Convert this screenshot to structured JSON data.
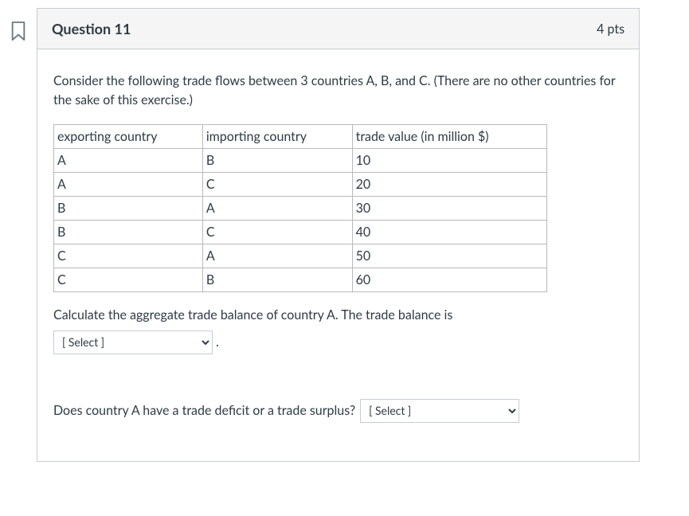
{
  "header": {
    "title": "Question 11",
    "points": "4 pts"
  },
  "body": {
    "intro": "Consider the following trade flows between 3 countries A, B, and C. (There are no other countries for the sake of this exercise.)",
    "table": {
      "headers": [
        "exporting country",
        "importing country",
        "trade value (in million $)"
      ],
      "rows": [
        [
          "A",
          "B",
          "10"
        ],
        [
          "A",
          "C",
          "20"
        ],
        [
          "B",
          "A",
          "30"
        ],
        [
          "B",
          "C",
          "40"
        ],
        [
          "C",
          "A",
          "50"
        ],
        [
          "C",
          "B",
          "60"
        ]
      ]
    },
    "q1_text": "Calculate the aggregate trade balance of country A. The trade balance is",
    "q1_placeholder": "[ Select ]",
    "q1_after": ".",
    "q2_text": "Does country A have a trade deficit or a trade surplus?",
    "q2_placeholder": "[ Select ]"
  }
}
